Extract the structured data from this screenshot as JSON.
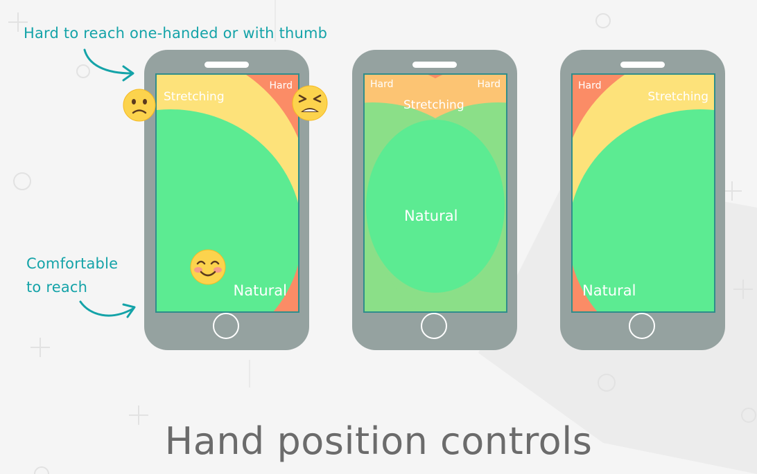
{
  "annotations": {
    "hard_to_reach": "Hard to reach one-handed or with thumb",
    "comfortable_line1": "Comfortable",
    "comfortable_line2": "to reach"
  },
  "phones": [
    {
      "hard": "Hard",
      "stretching": "Stretching",
      "natural": "Natural"
    },
    {
      "hard_left": "Hard",
      "hard_right": "Hard",
      "stretching": "Stretching",
      "natural": "Natural"
    },
    {
      "hard": "Hard",
      "stretching": "Stretching",
      "natural": "Natural"
    }
  ],
  "title": "Hand position controls",
  "colors": {
    "natural": "#5ceb92",
    "stretching": "#fde27a",
    "hard": "#fb8c66",
    "phone_body": "#95a2a0",
    "annotation": "#14a3a8",
    "title": "#6b6b6b"
  },
  "icons": [
    "slightly-frowning-face-icon",
    "tired-face-icon",
    "smiling-face-icon",
    "curved-arrow-icon"
  ]
}
